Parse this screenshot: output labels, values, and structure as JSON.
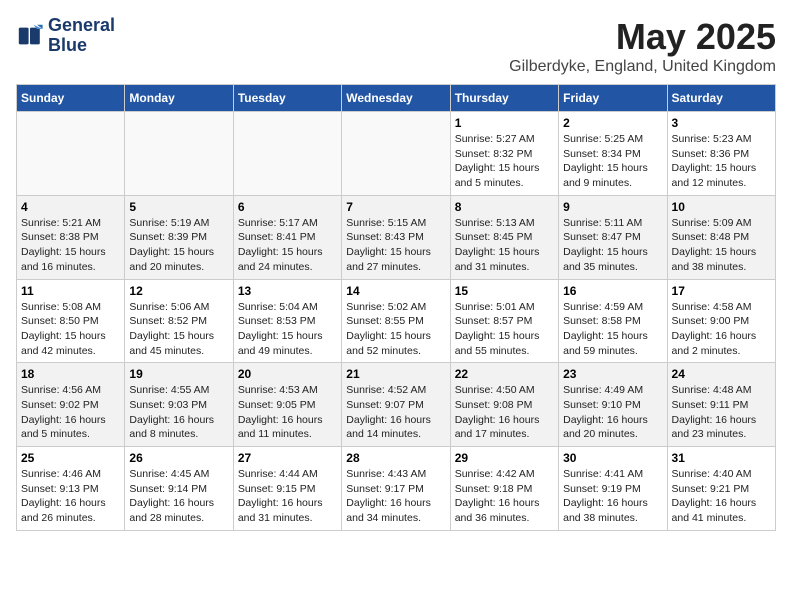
{
  "header": {
    "logo_line1": "General",
    "logo_line2": "Blue",
    "month": "May 2025",
    "location": "Gilberdyke, England, United Kingdom"
  },
  "weekdays": [
    "Sunday",
    "Monday",
    "Tuesday",
    "Wednesday",
    "Thursday",
    "Friday",
    "Saturday"
  ],
  "weeks": [
    [
      {
        "day": "",
        "info": ""
      },
      {
        "day": "",
        "info": ""
      },
      {
        "day": "",
        "info": ""
      },
      {
        "day": "",
        "info": ""
      },
      {
        "day": "1",
        "info": "Sunrise: 5:27 AM\nSunset: 8:32 PM\nDaylight: 15 hours\nand 5 minutes."
      },
      {
        "day": "2",
        "info": "Sunrise: 5:25 AM\nSunset: 8:34 PM\nDaylight: 15 hours\nand 9 minutes."
      },
      {
        "day": "3",
        "info": "Sunrise: 5:23 AM\nSunset: 8:36 PM\nDaylight: 15 hours\nand 12 minutes."
      }
    ],
    [
      {
        "day": "4",
        "info": "Sunrise: 5:21 AM\nSunset: 8:38 PM\nDaylight: 15 hours\nand 16 minutes."
      },
      {
        "day": "5",
        "info": "Sunrise: 5:19 AM\nSunset: 8:39 PM\nDaylight: 15 hours\nand 20 minutes."
      },
      {
        "day": "6",
        "info": "Sunrise: 5:17 AM\nSunset: 8:41 PM\nDaylight: 15 hours\nand 24 minutes."
      },
      {
        "day": "7",
        "info": "Sunrise: 5:15 AM\nSunset: 8:43 PM\nDaylight: 15 hours\nand 27 minutes."
      },
      {
        "day": "8",
        "info": "Sunrise: 5:13 AM\nSunset: 8:45 PM\nDaylight: 15 hours\nand 31 minutes."
      },
      {
        "day": "9",
        "info": "Sunrise: 5:11 AM\nSunset: 8:47 PM\nDaylight: 15 hours\nand 35 minutes."
      },
      {
        "day": "10",
        "info": "Sunrise: 5:09 AM\nSunset: 8:48 PM\nDaylight: 15 hours\nand 38 minutes."
      }
    ],
    [
      {
        "day": "11",
        "info": "Sunrise: 5:08 AM\nSunset: 8:50 PM\nDaylight: 15 hours\nand 42 minutes."
      },
      {
        "day": "12",
        "info": "Sunrise: 5:06 AM\nSunset: 8:52 PM\nDaylight: 15 hours\nand 45 minutes."
      },
      {
        "day": "13",
        "info": "Sunrise: 5:04 AM\nSunset: 8:53 PM\nDaylight: 15 hours\nand 49 minutes."
      },
      {
        "day": "14",
        "info": "Sunrise: 5:02 AM\nSunset: 8:55 PM\nDaylight: 15 hours\nand 52 minutes."
      },
      {
        "day": "15",
        "info": "Sunrise: 5:01 AM\nSunset: 8:57 PM\nDaylight: 15 hours\nand 55 minutes."
      },
      {
        "day": "16",
        "info": "Sunrise: 4:59 AM\nSunset: 8:58 PM\nDaylight: 15 hours\nand 59 minutes."
      },
      {
        "day": "17",
        "info": "Sunrise: 4:58 AM\nSunset: 9:00 PM\nDaylight: 16 hours\nand 2 minutes."
      }
    ],
    [
      {
        "day": "18",
        "info": "Sunrise: 4:56 AM\nSunset: 9:02 PM\nDaylight: 16 hours\nand 5 minutes."
      },
      {
        "day": "19",
        "info": "Sunrise: 4:55 AM\nSunset: 9:03 PM\nDaylight: 16 hours\nand 8 minutes."
      },
      {
        "day": "20",
        "info": "Sunrise: 4:53 AM\nSunset: 9:05 PM\nDaylight: 16 hours\nand 11 minutes."
      },
      {
        "day": "21",
        "info": "Sunrise: 4:52 AM\nSunset: 9:07 PM\nDaylight: 16 hours\nand 14 minutes."
      },
      {
        "day": "22",
        "info": "Sunrise: 4:50 AM\nSunset: 9:08 PM\nDaylight: 16 hours\nand 17 minutes."
      },
      {
        "day": "23",
        "info": "Sunrise: 4:49 AM\nSunset: 9:10 PM\nDaylight: 16 hours\nand 20 minutes."
      },
      {
        "day": "24",
        "info": "Sunrise: 4:48 AM\nSunset: 9:11 PM\nDaylight: 16 hours\nand 23 minutes."
      }
    ],
    [
      {
        "day": "25",
        "info": "Sunrise: 4:46 AM\nSunset: 9:13 PM\nDaylight: 16 hours\nand 26 minutes."
      },
      {
        "day": "26",
        "info": "Sunrise: 4:45 AM\nSunset: 9:14 PM\nDaylight: 16 hours\nand 28 minutes."
      },
      {
        "day": "27",
        "info": "Sunrise: 4:44 AM\nSunset: 9:15 PM\nDaylight: 16 hours\nand 31 minutes."
      },
      {
        "day": "28",
        "info": "Sunrise: 4:43 AM\nSunset: 9:17 PM\nDaylight: 16 hours\nand 34 minutes."
      },
      {
        "day": "29",
        "info": "Sunrise: 4:42 AM\nSunset: 9:18 PM\nDaylight: 16 hours\nand 36 minutes."
      },
      {
        "day": "30",
        "info": "Sunrise: 4:41 AM\nSunset: 9:19 PM\nDaylight: 16 hours\nand 38 minutes."
      },
      {
        "day": "31",
        "info": "Sunrise: 4:40 AM\nSunset: 9:21 PM\nDaylight: 16 hours\nand 41 minutes."
      }
    ]
  ]
}
